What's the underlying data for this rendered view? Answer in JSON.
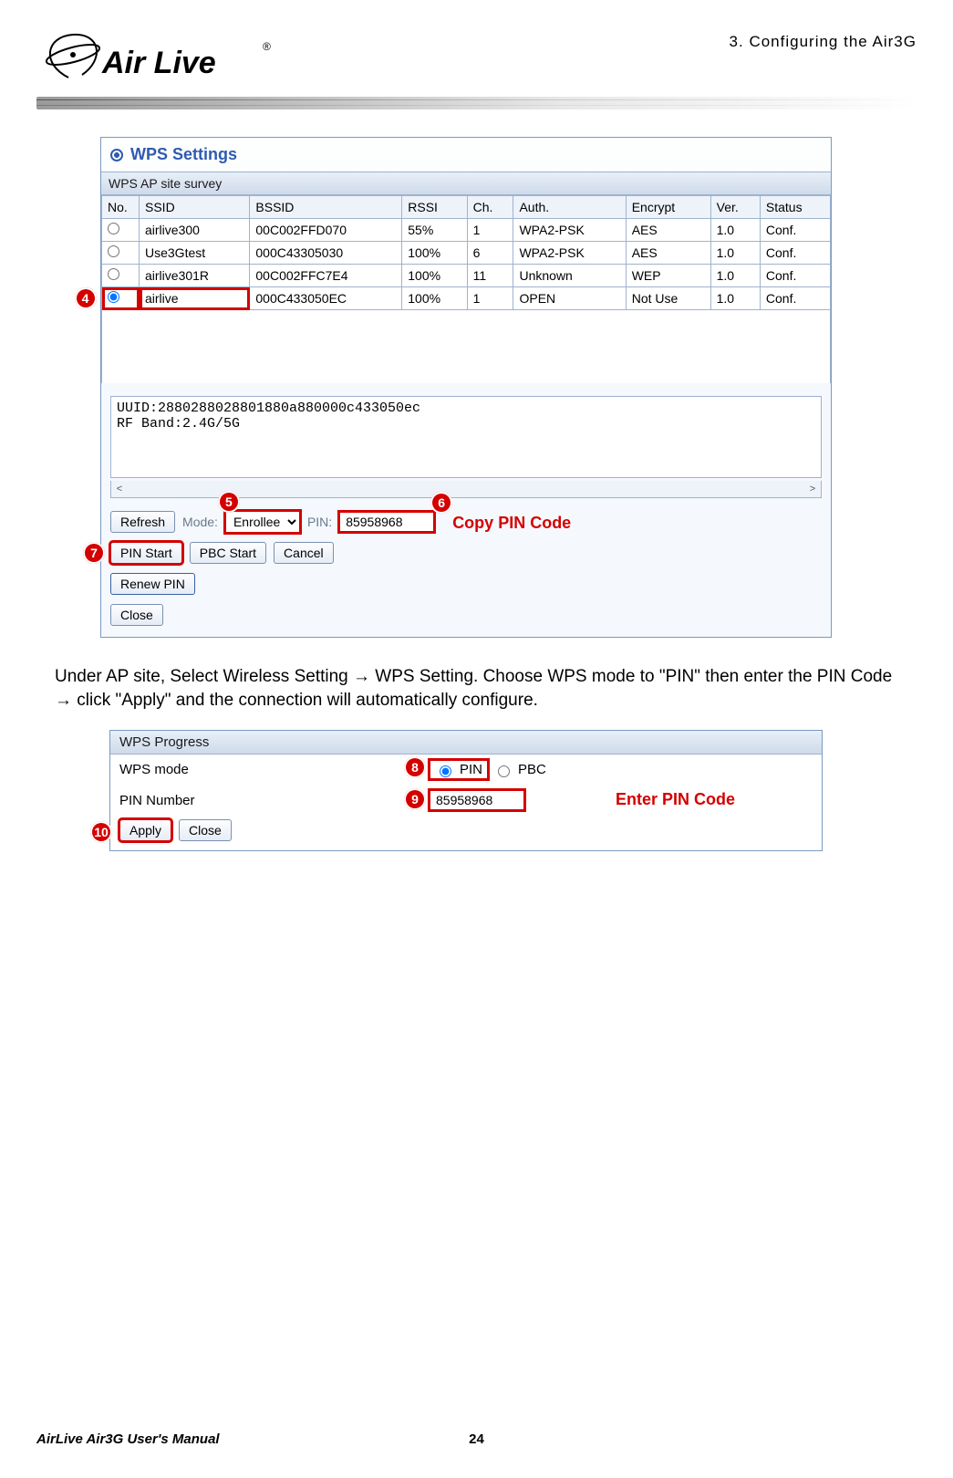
{
  "chapter_header": "3. Configuring the Air3G",
  "logo_text": "Air Live",
  "logo_reg": "®",
  "wps_settings": {
    "title": "WPS Settings",
    "survey_label": "WPS AP site survey",
    "columns": [
      "No.",
      "SSID",
      "BSSID",
      "RSSI",
      "Ch.",
      "Auth.",
      "Encrypt",
      "Ver.",
      "Status"
    ],
    "rows": [
      {
        "selected": false,
        "ssid": "airlive300",
        "bssid": "00C002FFD070",
        "rssi": "55%",
        "ch": "1",
        "auth": "WPA2-PSK",
        "encrypt": "AES",
        "ver": "1.0",
        "status": "Conf."
      },
      {
        "selected": false,
        "ssid": "Use3Gtest",
        "bssid": "000C43305030",
        "rssi": "100%",
        "ch": "6",
        "auth": "WPA2-PSK",
        "encrypt": "AES",
        "ver": "1.0",
        "status": "Conf."
      },
      {
        "selected": false,
        "ssid": "airlive301R",
        "bssid": "00C002FFC7E4",
        "rssi": "100%",
        "ch": "11",
        "auth": "Unknown",
        "encrypt": "WEP",
        "ver": "1.0",
        "status": "Conf."
      },
      {
        "selected": true,
        "ssid": "airlive",
        "bssid": "000C433050EC",
        "rssi": "100%",
        "ch": "1",
        "auth": "OPEN",
        "encrypt": "Not Use",
        "ver": "1.0",
        "status": "Conf."
      }
    ],
    "uuid_text": "UUID:2880288028801880a880000c433050ec\nRF Band:2.4G/5G",
    "buttons": {
      "refresh": "Refresh",
      "pin_start": "PIN Start",
      "pbc_start": "PBC Start",
      "cancel": "Cancel",
      "renew_pin": "Renew PIN",
      "close": "Close"
    },
    "mode_label": "Mode:",
    "mode_value": "Enrollee",
    "pin_label": "PIN:",
    "pin_value": "85958968"
  },
  "callouts": {
    "c4": "4",
    "c5": "5",
    "c6": "6",
    "c7": "7",
    "c8": "8",
    "c9": "9",
    "c10": "10",
    "copy_note": "Copy PIN Code",
    "enter_note": "Enter PIN Code"
  },
  "paragraph": "Under AP site, Select Wireless Setting → WPS Setting.    Choose WPS mode to \"PIN\" then enter the PIN Code → click \"Apply\" and the connection will automatically configure.",
  "wps_progress": {
    "header": "WPS Progress",
    "mode_label": "WPS mode",
    "pin_option": "PIN",
    "pbc_option": "PBC",
    "pin_number_label": "PIN Number",
    "pin_number_value": "85958968",
    "apply": "Apply",
    "close": "Close"
  },
  "footer": {
    "manual": "AirLive Air3G User's Manual",
    "page": "24"
  }
}
